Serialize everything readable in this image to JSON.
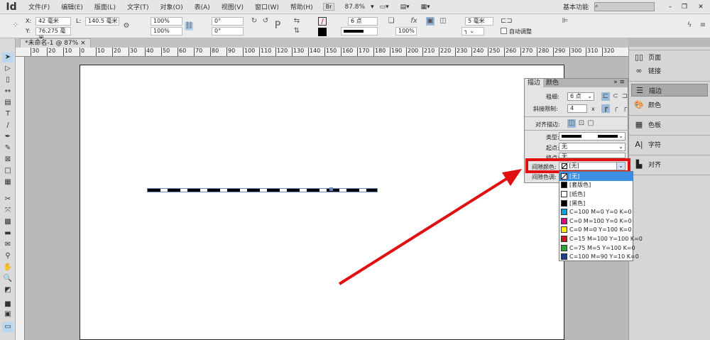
{
  "app": {
    "logo": "Id",
    "menus": [
      "文件(F)",
      "编辑(E)",
      "版面(L)",
      "文字(T)",
      "对象(O)",
      "表(A)",
      "视图(V)",
      "窗口(W)",
      "帮助(H)"
    ],
    "bridge": "Br",
    "zoom": "87.8%",
    "workspace": "基本功能",
    "search_placeholder": ""
  },
  "control": {
    "x_label": "X:",
    "x": "42 毫米",
    "y_label": "Y:",
    "y": "76.275 毫米",
    "l_label": "L:",
    "l": "140.5 毫米",
    "scale_x": "100%",
    "scale_y": "100%",
    "rotate": "0°",
    "shear": "0°",
    "stroke_weight": "6 点",
    "opacity": "100%",
    "offset": "5 毫米",
    "auto_fit": "自动调整"
  },
  "document": {
    "tab": "*未命名-1 @ 87%",
    "close": "×"
  },
  "ruler": {
    "h_labels": [
      "30",
      "20",
      "10",
      "0",
      "10",
      "20",
      "30",
      "40",
      "50",
      "60",
      "70",
      "80",
      "90",
      "100",
      "110",
      "120",
      "130",
      "140",
      "150",
      "160",
      "170",
      "180",
      "190",
      "200",
      "210",
      "220",
      "230",
      "240",
      "250",
      "260",
      "270",
      "280",
      "290",
      "300",
      "310",
      "320"
    ]
  },
  "right_panel": {
    "items": [
      "页面",
      "链接",
      "描边",
      "颜色",
      "色板",
      "字符",
      "对齐"
    ],
    "selected": 2
  },
  "stroke_panel": {
    "tabs": [
      "描边",
      "颜色"
    ],
    "weight_label": "粗细:",
    "weight": "6 点",
    "miter_label": "斜接限制:",
    "miter": "4",
    "miter_unit": "x",
    "align_label": "对齐描边:",
    "type_label": "类型:",
    "start_label": "起点:",
    "start": "无",
    "end_label": "终点:",
    "end": "无",
    "gap_color_label": "间隙颜色:",
    "gap_color": "[无]",
    "gap_tint_label": "间隙色调:"
  },
  "dropdown": {
    "options": [
      {
        "label": "[无]",
        "color": "none"
      },
      {
        "label": "[套版色]",
        "color": "#000000"
      },
      {
        "label": "[纸色]",
        "color": "#ffffff"
      },
      {
        "label": "[黑色]",
        "color": "#000000"
      },
      {
        "label": "C=100 M=0 Y=0 K=0",
        "color": "#009fe3"
      },
      {
        "label": "C=0 M=100 Y=0 K=0",
        "color": "#e5007f"
      },
      {
        "label": "C=0 M=0 Y=100 K=0",
        "color": "#ffed00"
      },
      {
        "label": "C=15 M=100 Y=100 K=0",
        "color": "#d3121b"
      },
      {
        "label": "C=75 M=5 Y=100 K=0",
        "color": "#2ea538"
      },
      {
        "label": "C=100 M=90 Y=10 K=0",
        "color": "#1d3c8e"
      }
    ],
    "selected": 0
  },
  "colors": {
    "highlight": "#e01010",
    "select": "#3c8ee0"
  }
}
